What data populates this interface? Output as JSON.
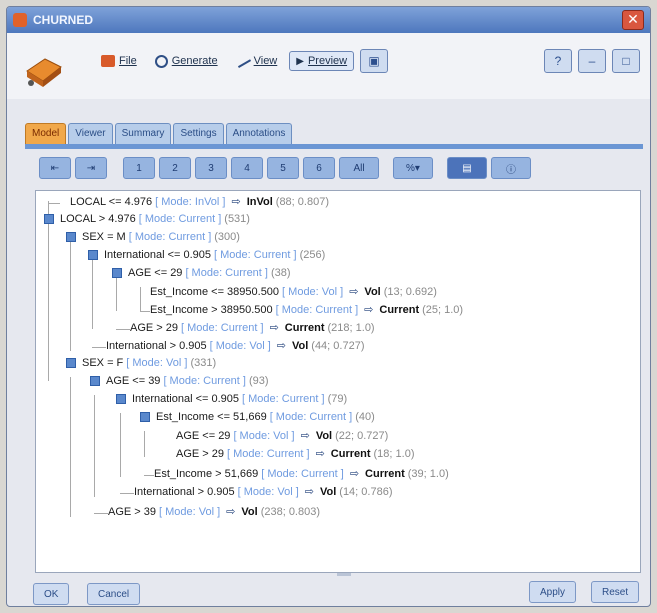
{
  "window": {
    "title": "CHURNED",
    "close_glyph": "✕"
  },
  "toolbar": {
    "file": "File",
    "generate": "Generate",
    "view": "View",
    "preview": "Preview"
  },
  "tabs": [
    "Model",
    "Viewer",
    "Summary",
    "Settings",
    "Annotations"
  ],
  "subtoolbar": {
    "levels": [
      "1",
      "2",
      "3",
      "4",
      "5",
      "6",
      "All"
    ],
    "percent": "%▾"
  },
  "tree": [
    {
      "cond": "LOCAL <= 4.976",
      "mode": "[ Mode: InVol ]",
      "pred": "InVol",
      "count": "(88; 0.807)"
    },
    {
      "cond": "LOCAL > 4.976",
      "mode": "[ Mode: Current ]",
      "pred": "",
      "count": "(531)"
    },
    {
      "cond": "SEX = M",
      "mode": "[ Mode: Current ]",
      "pred": "",
      "count": "(300)"
    },
    {
      "cond": "International <= 0.905",
      "mode": "[ Mode: Current ]",
      "pred": "",
      "count": "(256)"
    },
    {
      "cond": "AGE <= 29",
      "mode": "[ Mode: Current ]",
      "pred": "",
      "count": "(38)"
    },
    {
      "cond": "Est_Income <= 38950.500",
      "mode": "[ Mode: Vol ]",
      "pred": "Vol",
      "count": "(13; 0.692)"
    },
    {
      "cond": "Est_Income > 38950.500",
      "mode": "[ Mode: Current ]",
      "pred": "Current",
      "count": "(25; 1.0)"
    },
    {
      "cond": "AGE > 29",
      "mode": "[ Mode: Current ]",
      "pred": "Current",
      "count": "(218; 1.0)"
    },
    {
      "cond": "International > 0.905",
      "mode": "[ Mode: Vol ]",
      "pred": "Vol",
      "count": "(44; 0.727)"
    },
    {
      "cond": "SEX = F",
      "mode": "[ Mode: Vol ]",
      "pred": "",
      "count": "(331)"
    },
    {
      "cond": "AGE <= 39",
      "mode": "[ Mode: Current ]",
      "pred": "",
      "count": "(93)"
    },
    {
      "cond": "International <= 0.905",
      "mode": "[ Mode: Current ]",
      "pred": "",
      "count": "(79)"
    },
    {
      "cond": "Est_Income <= 51,669",
      "mode": "[ Mode: Current ]",
      "pred": "",
      "count": "(40)"
    },
    {
      "cond": "AGE <= 29",
      "mode": "[ Mode: Vol ]",
      "pred": "Vol",
      "count": "(22; 0.727)"
    },
    {
      "cond": "AGE > 29",
      "mode": "[ Mode: Current ]",
      "pred": "Current",
      "count": "(18; 1.0)"
    },
    {
      "cond": "Est_Income > 51,669",
      "mode": "[ Mode: Current ]",
      "pred": "Current",
      "count": "(39; 1.0)"
    },
    {
      "cond": "International > 0.905",
      "mode": "[ Mode: Vol ]",
      "pred": "Vol",
      "count": "(14; 0.786)"
    },
    {
      "cond": "AGE > 39",
      "mode": "[ Mode: Vol ]",
      "pred": "Vol",
      "count": "(238; 0.803)"
    }
  ],
  "footer": {
    "ok": "OK",
    "cancel": "Cancel",
    "apply": "Apply",
    "reset": "Reset"
  }
}
